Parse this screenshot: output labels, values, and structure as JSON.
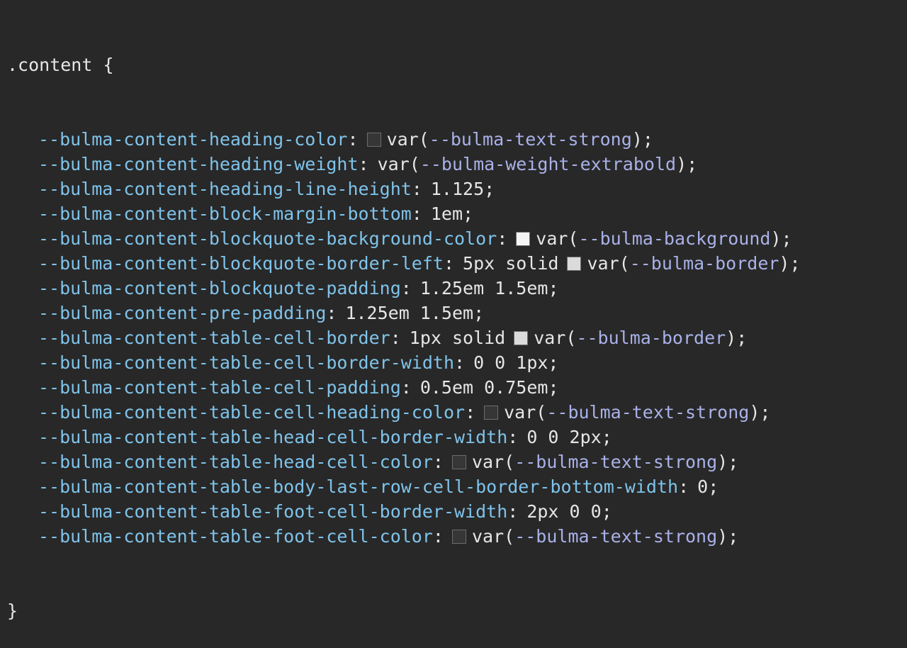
{
  "selector": ".content {",
  "closing": "}",
  "colors": {
    "text_strong": "#363636",
    "background": "#f5f5f5",
    "border": "#dbdbdb"
  },
  "declarations": [
    {
      "prop": "--bulma-content-heading-color",
      "swatch": "#363636",
      "value": "",
      "var": "--bulma-text-strong"
    },
    {
      "prop": "--bulma-content-heading-weight",
      "swatch": null,
      "value": "",
      "var": "--bulma-weight-extrabold"
    },
    {
      "prop": "--bulma-content-heading-line-height",
      "swatch": null,
      "value": "1.125",
      "var": null
    },
    {
      "prop": "--bulma-content-block-margin-bottom",
      "swatch": null,
      "value": "1em",
      "var": null
    },
    {
      "prop": "--bulma-content-blockquote-background-color",
      "swatch": "#f5f5f5",
      "value": "",
      "var": "--bulma-background"
    },
    {
      "prop": "--bulma-content-blockquote-border-left",
      "swatch": "#dbdbdb",
      "value": "5px solid",
      "var": "--bulma-border"
    },
    {
      "prop": "--bulma-content-blockquote-padding",
      "swatch": null,
      "value": "1.25em 1.5em",
      "var": null
    },
    {
      "prop": "--bulma-content-pre-padding",
      "swatch": null,
      "value": "1.25em 1.5em",
      "var": null
    },
    {
      "prop": "--bulma-content-table-cell-border",
      "swatch": "#dbdbdb",
      "value": "1px solid",
      "var": "--bulma-border"
    },
    {
      "prop": "--bulma-content-table-cell-border-width",
      "swatch": null,
      "value": "0 0 1px",
      "var": null
    },
    {
      "prop": "--bulma-content-table-cell-padding",
      "swatch": null,
      "value": "0.5em 0.75em",
      "var": null
    },
    {
      "prop": "--bulma-content-table-cell-heading-color",
      "swatch": "#363636",
      "value": "",
      "var": "--bulma-text-strong"
    },
    {
      "prop": "--bulma-content-table-head-cell-border-width",
      "swatch": null,
      "value": "0 0 2px",
      "var": null
    },
    {
      "prop": "--bulma-content-table-head-cell-color",
      "swatch": "#363636",
      "value": "",
      "var": "--bulma-text-strong"
    },
    {
      "prop": "--bulma-content-table-body-last-row-cell-border-bottom-width",
      "swatch": null,
      "value": "0",
      "var": null
    },
    {
      "prop": "--bulma-content-table-foot-cell-border-width",
      "swatch": null,
      "value": "2px 0 0",
      "var": null
    },
    {
      "prop": "--bulma-content-table-foot-cell-color",
      "swatch": "#363636",
      "value": "",
      "var": "--bulma-text-strong"
    }
  ]
}
